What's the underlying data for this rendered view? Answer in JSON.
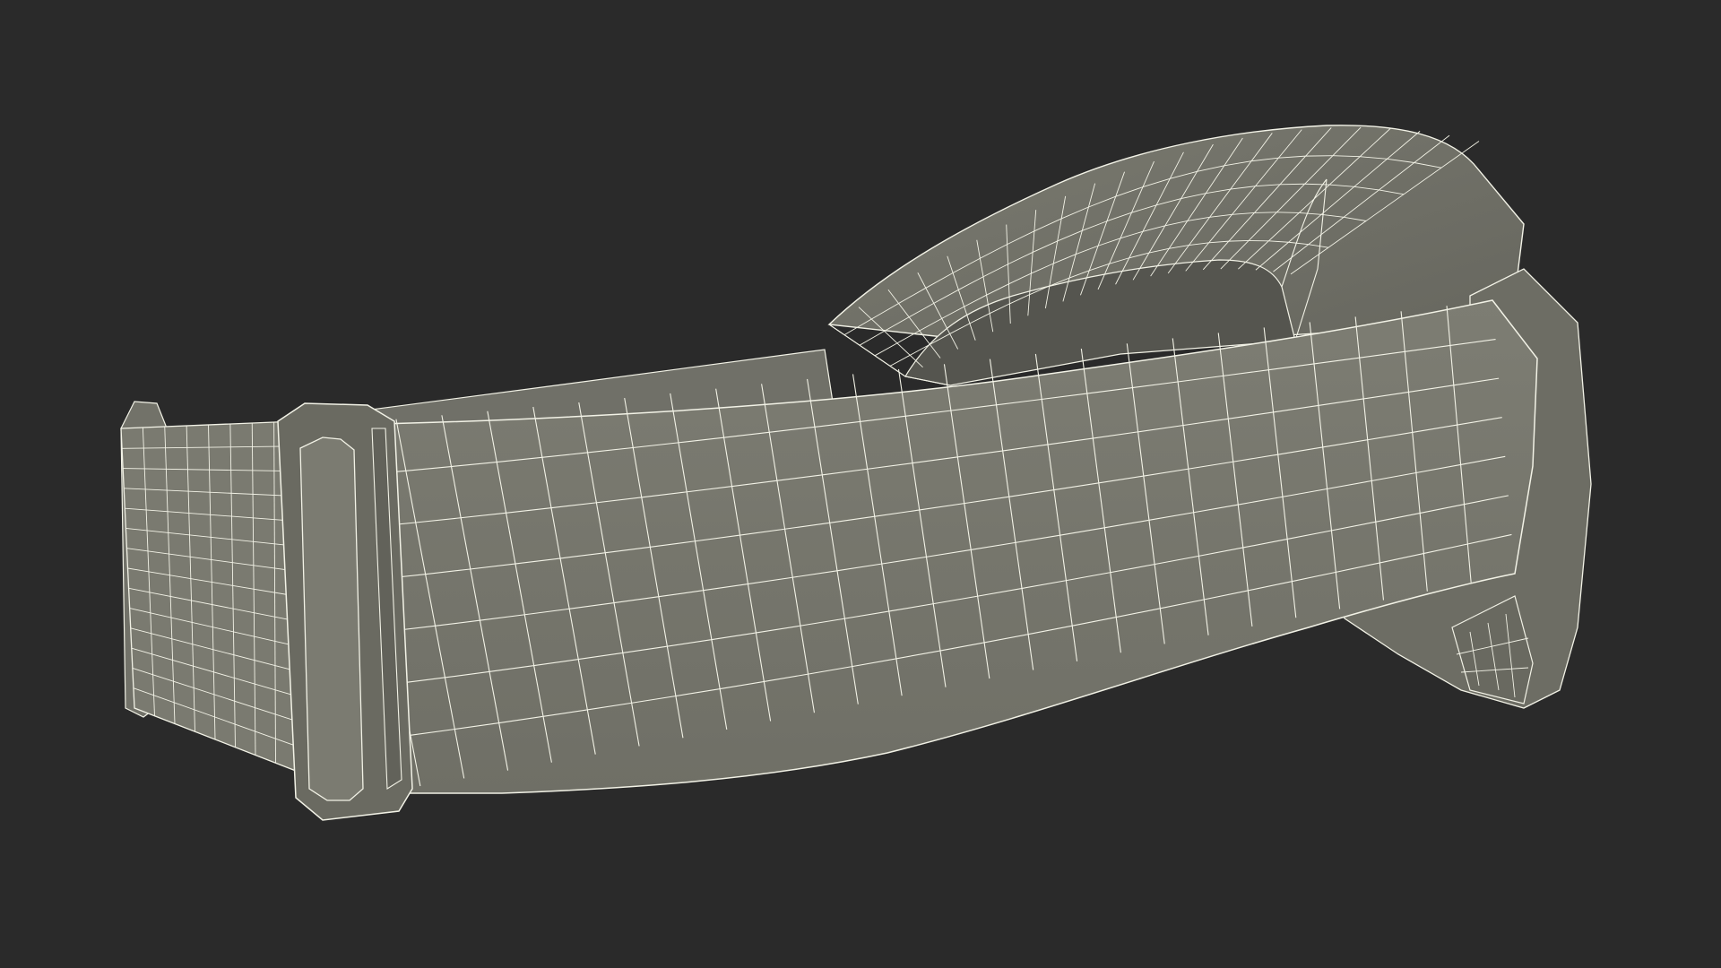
{
  "scene": {
    "background_color": "#2a2a2a",
    "model": {
      "surface_color": "#77776d",
      "shadow_color": "#5f5f57",
      "inner_color": "#55554f",
      "wire_color": "#f2f2e6",
      "style": "wireframe"
    }
  }
}
